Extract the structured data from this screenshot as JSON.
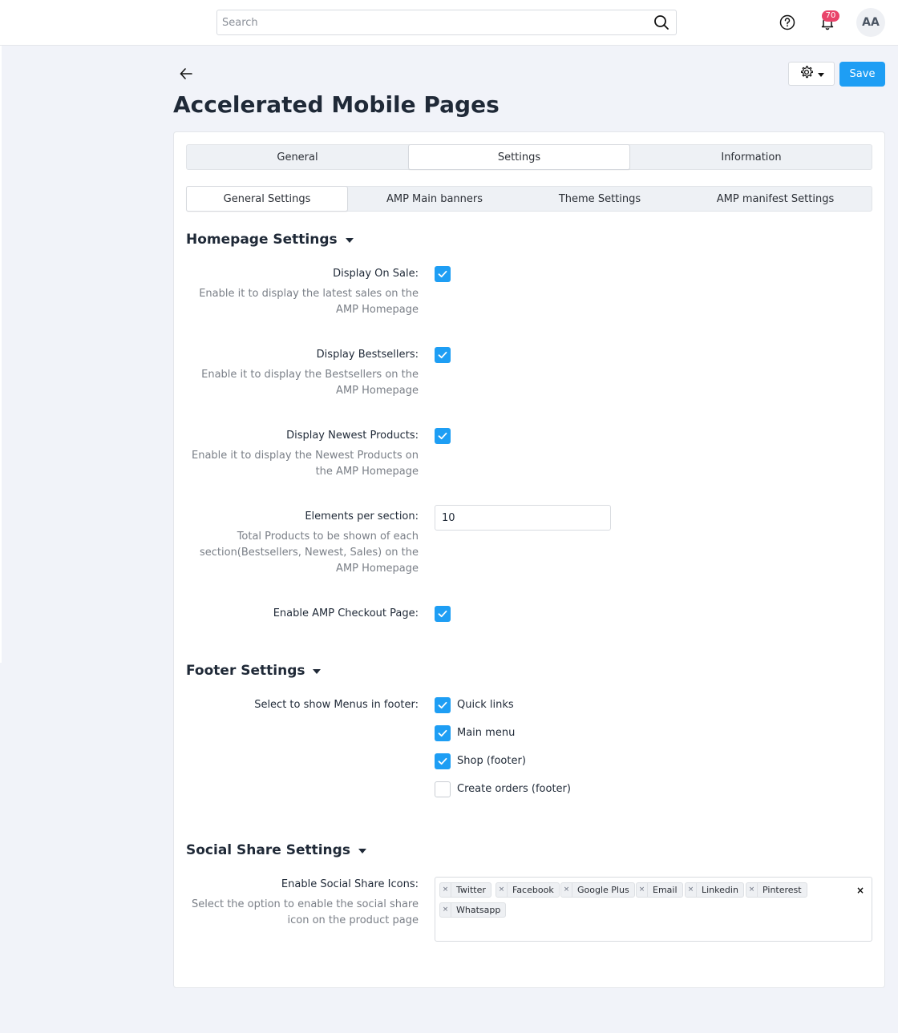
{
  "header": {
    "search_placeholder": "Search",
    "notifications_count": "70",
    "avatar_initials": "AA"
  },
  "page": {
    "title": "Accelerated Mobile Pages",
    "save_label": "Save"
  },
  "tabs": [
    "General",
    "Settings",
    "Information"
  ],
  "subtabs": [
    "General Settings",
    "AMP Main banners",
    "Theme Settings",
    "AMP manifest Settings"
  ],
  "homepage": {
    "heading": "Homepage Settings",
    "on_sale_label": "Display On Sale:",
    "on_sale_help": [
      "Enable it to display the latest sales on the",
      "AMP Homepage"
    ],
    "bestsellers_label": "Display Bestsellers:",
    "bestsellers_help": [
      "Enable it to display the Bestsellers on the",
      "AMP Homepage"
    ],
    "newest_label": "Display Newest Products:",
    "newest_help": [
      "Enable it to display the Newest Products on",
      "the AMP Homepage"
    ],
    "elements_label": "Elements per section:",
    "elements_value": "10",
    "elements_help": [
      "Total Products to be shown of each",
      "section(Bestsellers, Newest, Sales) on the",
      "AMP Homepage"
    ],
    "checkout_label": "Enable AMP Checkout Page:"
  },
  "footer": {
    "heading": "Footer Settings",
    "menus_label": "Select to show Menus in footer:",
    "menus": [
      "Quick links",
      "Main menu",
      "Shop (footer)",
      "Create orders (footer)"
    ]
  },
  "social": {
    "heading": "Social Share Settings",
    "icons_label": "Enable Social Share Icons:",
    "icons_help": [
      "Select the option to enable the social share",
      "icon on the product page"
    ],
    "tags": [
      "Twitter",
      "Facebook",
      "Google Plus",
      "Email",
      "Linkedin",
      "Pinterest",
      "Whatsapp"
    ],
    "clear_symbol": "×",
    "remove_symbol": "×"
  },
  "colors": {
    "accent": "#1e9ef4",
    "badge": "#e9446a",
    "background": "#f1f3f9"
  }
}
